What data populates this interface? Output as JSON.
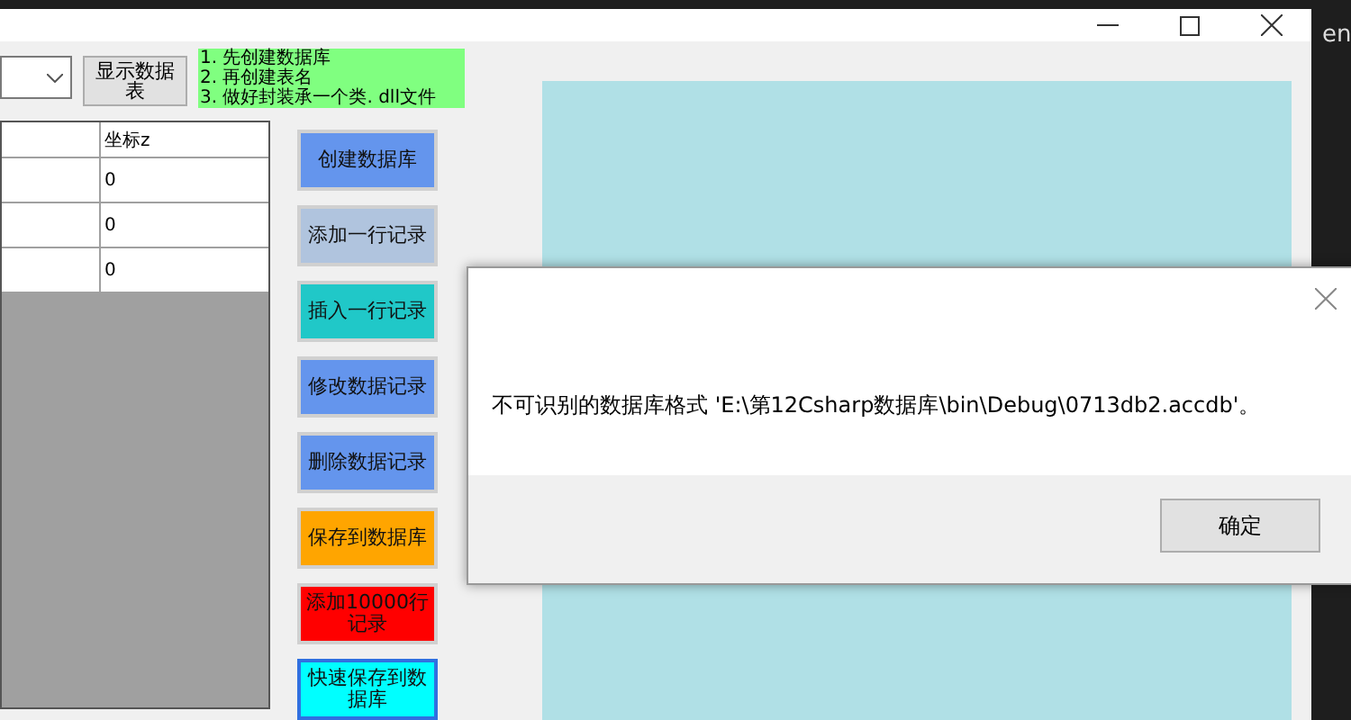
{
  "background_window": {
    "title_fragment": "en"
  },
  "toolbar": {
    "show_button": "显示数据表",
    "notes": [
      "1. 先创建数据库",
      "2. 再创建表名",
      "3. 做好封装承一个类. dll文件"
    ]
  },
  "table": {
    "columns": [
      "坐标z"
    ],
    "rows": [
      [
        "0"
      ],
      [
        "0"
      ],
      [
        "0"
      ]
    ]
  },
  "actions": [
    {
      "label": "创建数据库",
      "color": "#6495ed"
    },
    {
      "label": "添加一行记录",
      "color": "#b0c4de"
    },
    {
      "label": "插入一行记录",
      "color": "#20c8c8"
    },
    {
      "label": "修改数据记录",
      "color": "#6495ed"
    },
    {
      "label": "删除数据记录",
      "color": "#6495ed"
    },
    {
      "label": "保存到数据库",
      "color": "#ffa500"
    },
    {
      "label": "添加10000行记录",
      "color": "#ff0000"
    },
    {
      "label": "快速保存到数据库",
      "color": "#00ffff"
    }
  ],
  "dialog": {
    "message": "不可识别的数据库格式 'E:\\第12Csharp数据库\\bin\\Debug\\0713db2.accdb'。",
    "ok_button": "确定"
  }
}
